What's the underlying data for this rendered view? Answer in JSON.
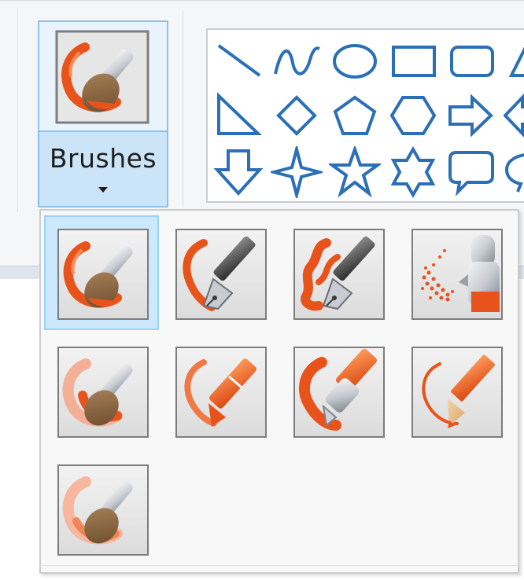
{
  "ribbon": {
    "brushes_button": {
      "label": "Brushes",
      "icon": "paintbrush-icon"
    },
    "shapes_gallery": {
      "rows": [
        [
          "line-shape",
          "curve-shape",
          "oval-shape",
          "rectangle-shape",
          "rounded-rectangle-shape",
          "polygon-shape"
        ],
        [
          "right-triangle-shape",
          "diamond-shape",
          "pentagon-shape",
          "hexagon-shape",
          "right-arrow-shape",
          "left-arrow-shape"
        ],
        [
          "down-arrow-shape",
          "four-point-star-shape",
          "five-point-star-shape",
          "six-point-star-shape",
          "rounded-callout-shape",
          "oval-callout-shape"
        ]
      ]
    }
  },
  "brush_menu": {
    "items": [
      {
        "name": "brush",
        "icon": "brush-icon",
        "selected": true
      },
      {
        "name": "calligraphy-brush-1",
        "icon": "calligraphy-pen-icon",
        "selected": false
      },
      {
        "name": "calligraphy-brush-2",
        "icon": "calligraphy-pen-2-icon",
        "selected": false
      },
      {
        "name": "airbrush",
        "icon": "airbrush-icon",
        "selected": false
      },
      {
        "name": "oil-brush",
        "icon": "oil-brush-icon",
        "selected": false
      },
      {
        "name": "crayon",
        "icon": "crayon-icon",
        "selected": false
      },
      {
        "name": "marker",
        "icon": "marker-icon",
        "selected": false
      },
      {
        "name": "natural-pencil",
        "icon": "natural-pencil-icon",
        "selected": false
      },
      {
        "name": "watercolor-brush",
        "icon": "watercolor-brush-icon",
        "selected": false
      }
    ]
  },
  "colors": {
    "accent_orange": "#e8531c",
    "selection_blue": "#cce8ff",
    "shape_blue": "#2b6fb6"
  }
}
